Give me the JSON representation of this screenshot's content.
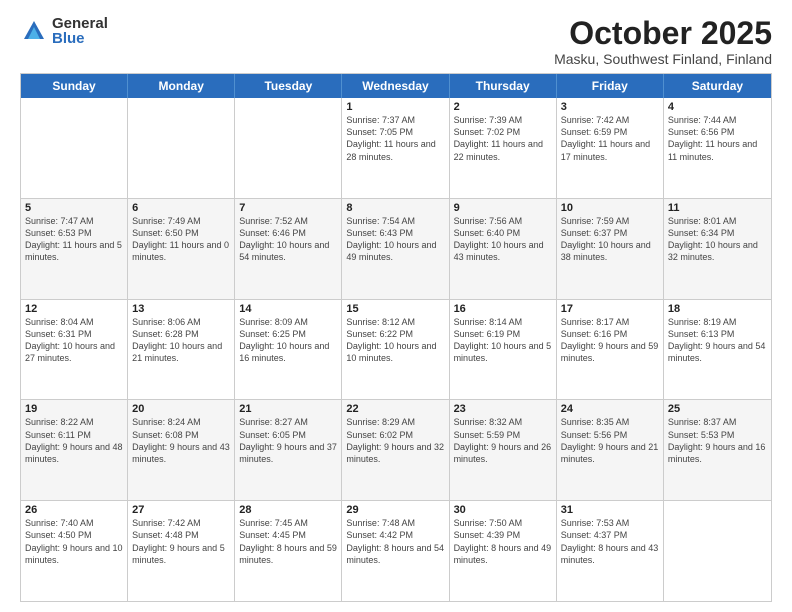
{
  "logo": {
    "general": "General",
    "blue": "Blue"
  },
  "title": "October 2025",
  "location": "Masku, Southwest Finland, Finland",
  "weekdays": [
    "Sunday",
    "Monday",
    "Tuesday",
    "Wednesday",
    "Thursday",
    "Friday",
    "Saturday"
  ],
  "rows": [
    [
      {
        "day": "",
        "info": ""
      },
      {
        "day": "",
        "info": ""
      },
      {
        "day": "",
        "info": ""
      },
      {
        "day": "1",
        "info": "Sunrise: 7:37 AM\nSunset: 7:05 PM\nDaylight: 11 hours and 28 minutes."
      },
      {
        "day": "2",
        "info": "Sunrise: 7:39 AM\nSunset: 7:02 PM\nDaylight: 11 hours and 22 minutes."
      },
      {
        "day": "3",
        "info": "Sunrise: 7:42 AM\nSunset: 6:59 PM\nDaylight: 11 hours and 17 minutes."
      },
      {
        "day": "4",
        "info": "Sunrise: 7:44 AM\nSunset: 6:56 PM\nDaylight: 11 hours and 11 minutes."
      }
    ],
    [
      {
        "day": "5",
        "info": "Sunrise: 7:47 AM\nSunset: 6:53 PM\nDaylight: 11 hours and 5 minutes."
      },
      {
        "day": "6",
        "info": "Sunrise: 7:49 AM\nSunset: 6:50 PM\nDaylight: 11 hours and 0 minutes."
      },
      {
        "day": "7",
        "info": "Sunrise: 7:52 AM\nSunset: 6:46 PM\nDaylight: 10 hours and 54 minutes."
      },
      {
        "day": "8",
        "info": "Sunrise: 7:54 AM\nSunset: 6:43 PM\nDaylight: 10 hours and 49 minutes."
      },
      {
        "day": "9",
        "info": "Sunrise: 7:56 AM\nSunset: 6:40 PM\nDaylight: 10 hours and 43 minutes."
      },
      {
        "day": "10",
        "info": "Sunrise: 7:59 AM\nSunset: 6:37 PM\nDaylight: 10 hours and 38 minutes."
      },
      {
        "day": "11",
        "info": "Sunrise: 8:01 AM\nSunset: 6:34 PM\nDaylight: 10 hours and 32 minutes."
      }
    ],
    [
      {
        "day": "12",
        "info": "Sunrise: 8:04 AM\nSunset: 6:31 PM\nDaylight: 10 hours and 27 minutes."
      },
      {
        "day": "13",
        "info": "Sunrise: 8:06 AM\nSunset: 6:28 PM\nDaylight: 10 hours and 21 minutes."
      },
      {
        "day": "14",
        "info": "Sunrise: 8:09 AM\nSunset: 6:25 PM\nDaylight: 10 hours and 16 minutes."
      },
      {
        "day": "15",
        "info": "Sunrise: 8:12 AM\nSunset: 6:22 PM\nDaylight: 10 hours and 10 minutes."
      },
      {
        "day": "16",
        "info": "Sunrise: 8:14 AM\nSunset: 6:19 PM\nDaylight: 10 hours and 5 minutes."
      },
      {
        "day": "17",
        "info": "Sunrise: 8:17 AM\nSunset: 6:16 PM\nDaylight: 9 hours and 59 minutes."
      },
      {
        "day": "18",
        "info": "Sunrise: 8:19 AM\nSunset: 6:13 PM\nDaylight: 9 hours and 54 minutes."
      }
    ],
    [
      {
        "day": "19",
        "info": "Sunrise: 8:22 AM\nSunset: 6:11 PM\nDaylight: 9 hours and 48 minutes."
      },
      {
        "day": "20",
        "info": "Sunrise: 8:24 AM\nSunset: 6:08 PM\nDaylight: 9 hours and 43 minutes."
      },
      {
        "day": "21",
        "info": "Sunrise: 8:27 AM\nSunset: 6:05 PM\nDaylight: 9 hours and 37 minutes."
      },
      {
        "day": "22",
        "info": "Sunrise: 8:29 AM\nSunset: 6:02 PM\nDaylight: 9 hours and 32 minutes."
      },
      {
        "day": "23",
        "info": "Sunrise: 8:32 AM\nSunset: 5:59 PM\nDaylight: 9 hours and 26 minutes."
      },
      {
        "day": "24",
        "info": "Sunrise: 8:35 AM\nSunset: 5:56 PM\nDaylight: 9 hours and 21 minutes."
      },
      {
        "day": "25",
        "info": "Sunrise: 8:37 AM\nSunset: 5:53 PM\nDaylight: 9 hours and 16 minutes."
      }
    ],
    [
      {
        "day": "26",
        "info": "Sunrise: 7:40 AM\nSunset: 4:50 PM\nDaylight: 9 hours and 10 minutes."
      },
      {
        "day": "27",
        "info": "Sunrise: 7:42 AM\nSunset: 4:48 PM\nDaylight: 9 hours and 5 minutes."
      },
      {
        "day": "28",
        "info": "Sunrise: 7:45 AM\nSunset: 4:45 PM\nDaylight: 8 hours and 59 minutes."
      },
      {
        "day": "29",
        "info": "Sunrise: 7:48 AM\nSunset: 4:42 PM\nDaylight: 8 hours and 54 minutes."
      },
      {
        "day": "30",
        "info": "Sunrise: 7:50 AM\nSunset: 4:39 PM\nDaylight: 8 hours and 49 minutes."
      },
      {
        "day": "31",
        "info": "Sunrise: 7:53 AM\nSunset: 4:37 PM\nDaylight: 8 hours and 43 minutes."
      },
      {
        "day": "",
        "info": ""
      }
    ]
  ],
  "alt_rows": [
    1,
    3
  ]
}
